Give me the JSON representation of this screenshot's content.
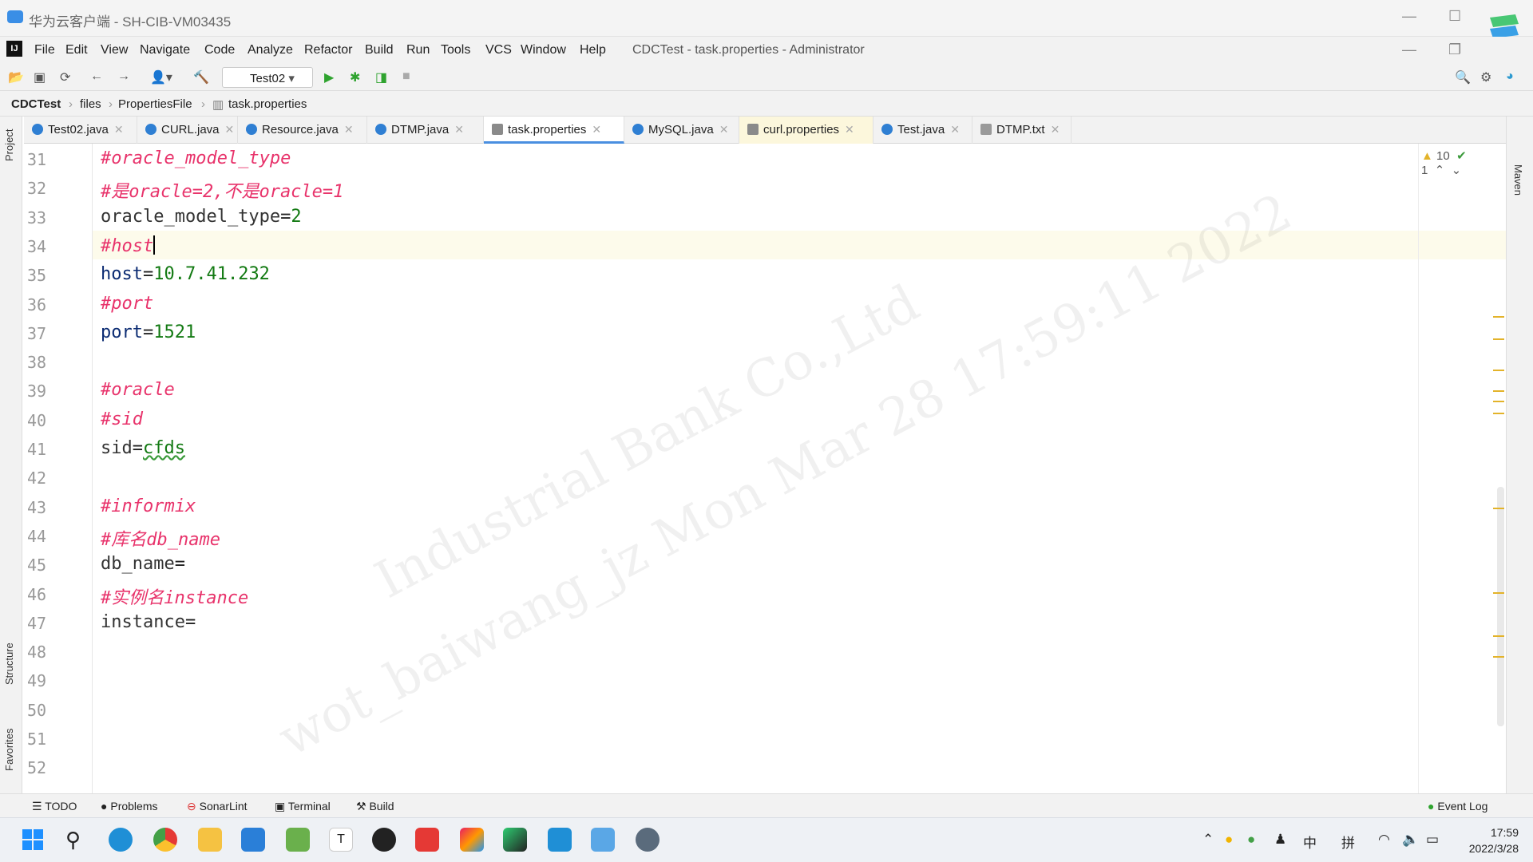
{
  "remote_window": {
    "title": "华为云客户端 - SH-CIB-VM03435"
  },
  "menu": {
    "logo": "IJ",
    "items": [
      "File",
      "Edit",
      "View",
      "Navigate",
      "Code",
      "Analyze",
      "Refactor",
      "Build",
      "Run",
      "Tools",
      "VCS",
      "Window",
      "Help"
    ],
    "project_title": "CDCTest - task.properties - Administrator"
  },
  "toolbar": {
    "run_config": "Test02"
  },
  "breadcrumb": [
    "CDCTest",
    "files",
    "PropertiesFile",
    "task.properties"
  ],
  "tabs": [
    {
      "label": "Test02.java"
    },
    {
      "label": "CURL.java"
    },
    {
      "label": "Resource.java"
    },
    {
      "label": "DTMP.java"
    },
    {
      "label": "task.properties"
    },
    {
      "label": "MySQL.java"
    },
    {
      "label": "curl.properties"
    },
    {
      "label": "Test.java"
    },
    {
      "label": "DTMP.txt"
    }
  ],
  "side_tools": {
    "left_top": "Project",
    "left_mid": "Structure",
    "left_bottom": "Favorites",
    "right": "Maven"
  },
  "inspections": {
    "warnings": "10",
    "ok": "1"
  },
  "editor": {
    "lines": [
      {
        "n": "31",
        "text": "#oracle_model_type"
      },
      {
        "n": "32",
        "text": "#是oracle=2,不是oracle=1"
      },
      {
        "n": "33",
        "key": "oracle_model_type",
        "val": "2"
      },
      {
        "n": "34",
        "text": "#host"
      },
      {
        "n": "35",
        "key": "host",
        "val": "10.7.41.232"
      },
      {
        "n": "36",
        "text": "#port"
      },
      {
        "n": "37",
        "key": "port",
        "val": "1521"
      },
      {
        "n": "38"
      },
      {
        "n": "39",
        "text": "#oracle"
      },
      {
        "n": "40",
        "text": "#sid"
      },
      {
        "n": "41",
        "key": "sid",
        "val": "cfds"
      },
      {
        "n": "42"
      },
      {
        "n": "43",
        "text": "#informix"
      },
      {
        "n": "44",
        "text": "#库名db_name"
      },
      {
        "n": "45",
        "key": "db_name",
        "val": ""
      },
      {
        "n": "46",
        "text": "#实例名instance"
      },
      {
        "n": "47",
        "key": "instance",
        "val": ""
      },
      {
        "n": "48"
      },
      {
        "n": "49"
      },
      {
        "n": "50"
      },
      {
        "n": "51"
      },
      {
        "n": "52"
      }
    ],
    "watermark_line1": "Industrial Bank Co.,Ltd",
    "watermark_line2": "wot_baiwang_jz Mon Mar 28 17:59:11 2022"
  },
  "bottom_tools": [
    "TODO",
    "Problems",
    "SonarLint",
    "Terminal",
    "Build"
  ],
  "event_log": "Event Log",
  "taskbar": {
    "ime1": "中",
    "ime2": "拼",
    "time": "17:59",
    "date": "2022/3/28"
  },
  "colors": {
    "accent": "#4a8fe0",
    "comment": "#e8336b",
    "value": "#137a13",
    "key": "#0b2b72"
  }
}
